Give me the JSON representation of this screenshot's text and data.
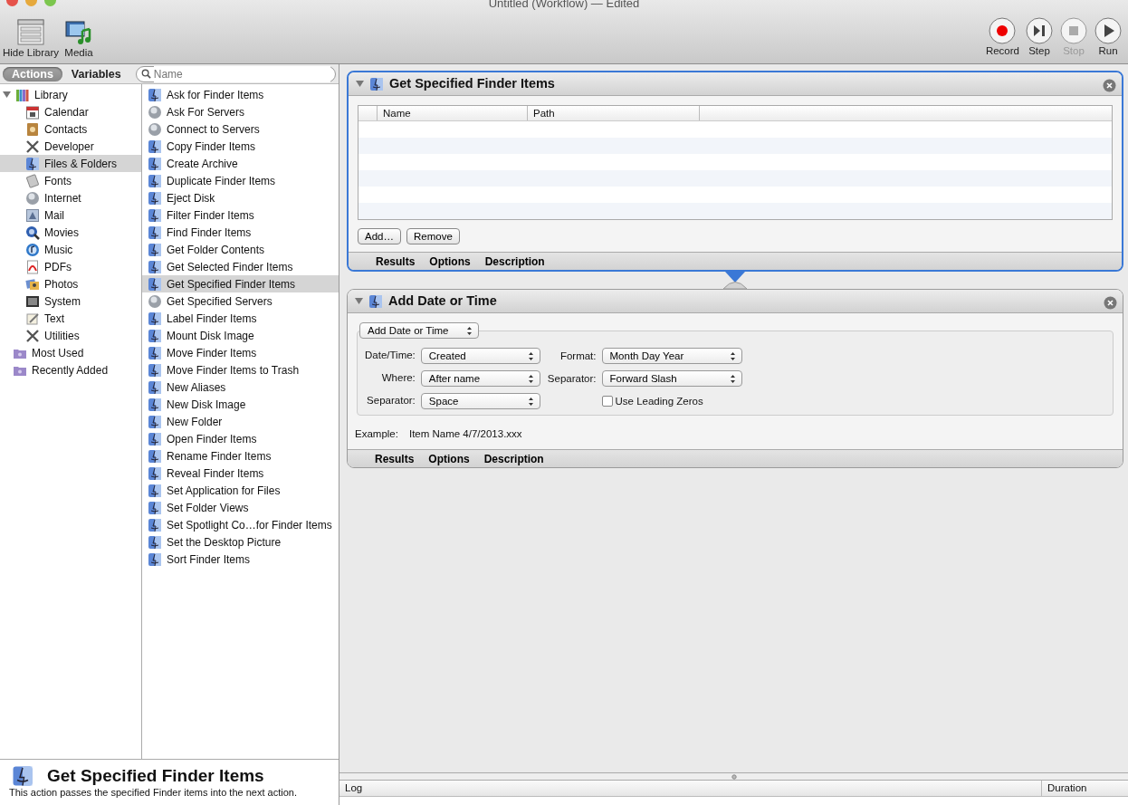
{
  "window": {
    "title": "Untitled (Workflow) — Edited"
  },
  "toolbar": {
    "left": [
      {
        "label": "Hide Library",
        "kind": "library"
      },
      {
        "label": "Media",
        "kind": "media"
      }
    ],
    "right": [
      {
        "label": "Record",
        "kind": "record",
        "disabled": false
      },
      {
        "label": "Step",
        "kind": "step",
        "disabled": false
      },
      {
        "label": "Stop",
        "kind": "stop",
        "disabled": true
      },
      {
        "label": "Run",
        "kind": "run",
        "disabled": false
      }
    ]
  },
  "library_tabs": [
    {
      "label": "Actions",
      "selected": true
    },
    {
      "label": "Variables",
      "selected": false
    }
  ],
  "search": {
    "placeholder": "Name"
  },
  "categories": [
    {
      "label": "Library",
      "kind": "library",
      "expanded": true,
      "selected": false,
      "children": [
        {
          "label": "Calendar",
          "kind": "calendar",
          "selected": false
        },
        {
          "label": "Contacts",
          "kind": "contacts",
          "selected": false
        },
        {
          "label": "Developer",
          "kind": "tools",
          "selected": false
        },
        {
          "label": "Files & Folders",
          "kind": "finder",
          "selected": true
        },
        {
          "label": "Fonts",
          "kind": "fonts",
          "selected": false
        },
        {
          "label": "Internet",
          "kind": "globe",
          "selected": false
        },
        {
          "label": "Mail",
          "kind": "mail",
          "selected": false
        },
        {
          "label": "Movies",
          "kind": "movies",
          "selected": false
        },
        {
          "label": "Music",
          "kind": "music",
          "selected": false
        },
        {
          "label": "PDFs",
          "kind": "pdf",
          "selected": false
        },
        {
          "label": "Photos",
          "kind": "photos",
          "selected": false
        },
        {
          "label": "System",
          "kind": "system",
          "selected": false
        },
        {
          "label": "Text",
          "kind": "text",
          "selected": false
        },
        {
          "label": "Utilities",
          "kind": "tools",
          "selected": false
        }
      ]
    },
    {
      "label": "Most Used",
      "kind": "smart",
      "selected": false
    },
    {
      "label": "Recently Added",
      "kind": "smart",
      "selected": false
    }
  ],
  "actions": [
    {
      "label": "Ask for Finder Items",
      "kind": "finder",
      "selected": false
    },
    {
      "label": "Ask For Servers",
      "kind": "globe",
      "selected": false
    },
    {
      "label": "Connect to Servers",
      "kind": "globe",
      "selected": false
    },
    {
      "label": "Copy Finder Items",
      "kind": "finder",
      "selected": false
    },
    {
      "label": "Create Archive",
      "kind": "finder",
      "selected": false
    },
    {
      "label": "Duplicate Finder Items",
      "kind": "finder",
      "selected": false
    },
    {
      "label": "Eject Disk",
      "kind": "finder",
      "selected": false
    },
    {
      "label": "Filter Finder Items",
      "kind": "finder",
      "selected": false
    },
    {
      "label": "Find Finder Items",
      "kind": "finder",
      "selected": false
    },
    {
      "label": "Get Folder Contents",
      "kind": "finder",
      "selected": false
    },
    {
      "label": "Get Selected Finder Items",
      "kind": "finder",
      "selected": false
    },
    {
      "label": "Get Specified Finder Items",
      "kind": "finder",
      "selected": true
    },
    {
      "label": "Get Specified Servers",
      "kind": "globe",
      "selected": false
    },
    {
      "label": "Label Finder Items",
      "kind": "finder",
      "selected": false
    },
    {
      "label": "Mount Disk Image",
      "kind": "finder",
      "selected": false
    },
    {
      "label": "Move Finder Items",
      "kind": "finder",
      "selected": false
    },
    {
      "label": "Move Finder Items to Trash",
      "kind": "finder",
      "selected": false
    },
    {
      "label": "New Aliases",
      "kind": "finder",
      "selected": false
    },
    {
      "label": "New Disk Image",
      "kind": "finder",
      "selected": false
    },
    {
      "label": "New Folder",
      "kind": "finder",
      "selected": false
    },
    {
      "label": "Open Finder Items",
      "kind": "finder",
      "selected": false
    },
    {
      "label": "Rename Finder Items",
      "kind": "finder",
      "selected": false
    },
    {
      "label": "Reveal Finder Items",
      "kind": "finder",
      "selected": false
    },
    {
      "label": "Set Application for Files",
      "kind": "finder",
      "selected": false
    },
    {
      "label": "Set Folder Views",
      "kind": "finder",
      "selected": false
    },
    {
      "label": "Set Spotlight Co…for Finder Items",
      "kind": "finder",
      "selected": false
    },
    {
      "label": "Set the Desktop Picture",
      "kind": "finder",
      "selected": false
    },
    {
      "label": "Sort Finder Items",
      "kind": "finder",
      "selected": false
    }
  ],
  "description": {
    "title": "Get Specified Finder Items",
    "text": "This action passes the specified Finder items into the next action."
  },
  "workflow": [
    {
      "title": "Get Specified Finder Items",
      "kind": "file_list",
      "expanded": true,
      "selected": true,
      "columns": [
        "Name",
        "Path"
      ],
      "buttons": [
        "Add…",
        "Remove"
      ],
      "footer_tabs": [
        "Results",
        "Options",
        "Description"
      ]
    },
    {
      "title": "Add Date or Time",
      "kind": "form",
      "expanded": true,
      "selected": false,
      "group_popup": "Add Date or Time",
      "left_fields": [
        {
          "label": "Date/Time:",
          "value": "Created"
        },
        {
          "label": "Where:",
          "value": "After name"
        },
        {
          "label": "Separator:",
          "value": "Space"
        }
      ],
      "right_fields": [
        {
          "label": "Format:",
          "value": "Month Day Year"
        },
        {
          "label": "Separator:",
          "value": "Forward Slash"
        }
      ],
      "checkbox": {
        "label": "Use Leading Zeros",
        "checked": false
      },
      "example_label": "Example:",
      "example": "Item Name 4/7/2013.xxx",
      "footer_tabs": [
        "Results",
        "Options",
        "Description"
      ]
    }
  ],
  "log": {
    "columns": [
      "Log",
      "Duration"
    ]
  }
}
